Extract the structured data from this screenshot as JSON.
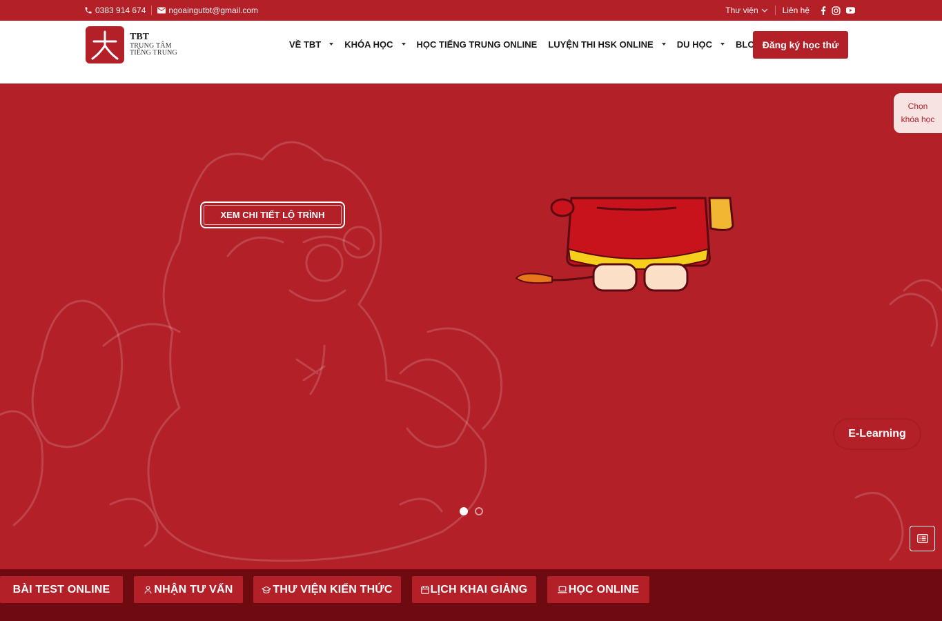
{
  "topbar": {
    "phone": "0383 914 674",
    "email": "ngoaingutbt@gmail.com",
    "library": "Thư viện",
    "contact": "Liên hệ",
    "social_icons": [
      "facebook-icon",
      "instagram-icon",
      "youtube-icon"
    ]
  },
  "logo": {
    "line1": "TBT",
    "line2": "TRUNG TÂM",
    "line3": "TIẾNG TRUNG"
  },
  "nav": {
    "items": [
      {
        "label": "VỀ TBT",
        "dropdown": true
      },
      {
        "label": "KHÓA HỌC",
        "dropdown": true
      },
      {
        "label": "HỌC TIẾNG TRUNG ONLINE",
        "dropdown": false
      },
      {
        "label": "LUYỆN THI HSK ONLINE",
        "dropdown": true
      },
      {
        "label": "DU HỌC",
        "dropdown": true
      },
      {
        "label": "BLOG",
        "dropdown": true
      }
    ],
    "cta": "Đăng ký học thử"
  },
  "hero": {
    "button": "XEM CHI TIẾT LỘ TRÌNH",
    "slides": 2,
    "active_slide": 1
  },
  "side": {
    "choose_line1": "Chọn",
    "choose_line2": "khóa học",
    "elearning": "E-Learning"
  },
  "bottom": {
    "items": [
      {
        "label": "BÀI TEST ONLINE",
        "icon": ""
      },
      {
        "label": "NHẬN TƯ VẤN",
        "icon": "support-icon"
      },
      {
        "label": "THƯ VIỆN KIẾN THỨC",
        "icon": "graduation-cap-icon"
      },
      {
        "label": "LỊCH KHAI GIẢNG",
        "icon": "calendar-icon"
      },
      {
        "label": "HỌC ONLINE",
        "icon": "laptop-icon"
      }
    ]
  },
  "colors": {
    "brand": "#b32028",
    "dark": "#6d0b10",
    "white": "#ffffff"
  }
}
